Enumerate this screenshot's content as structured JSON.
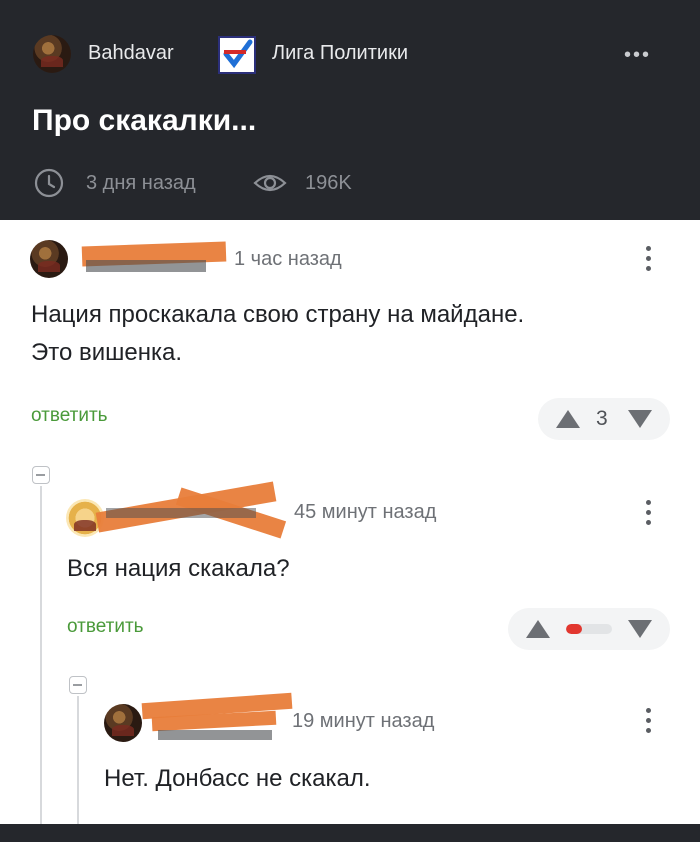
{
  "post": {
    "author": "Bahdavar",
    "community": "Лига Политики",
    "title": "Про скакалки...",
    "time": "3 дня назад",
    "views": "196K",
    "menu_icon": "more-horizontal-icon"
  },
  "comments": [
    {
      "time": "1 час назад",
      "text_line1": "Нация проскакала свою страну на майдане.",
      "text_line2": "Это вишенка.",
      "reply": "ответить",
      "score": "3"
    },
    {
      "time": "45 минут назад",
      "text": "Вся нация скакала?",
      "reply": "ответить",
      "rating_fraction": 0.35
    },
    {
      "time": "19 минут назад",
      "text": "Нет. Донбасс не скакал."
    }
  ],
  "colors": {
    "header_bg": "#25272c",
    "reply_green": "#4a9a3a",
    "censor_orange": "#e87d3a",
    "rating_red": "#e2372f"
  }
}
